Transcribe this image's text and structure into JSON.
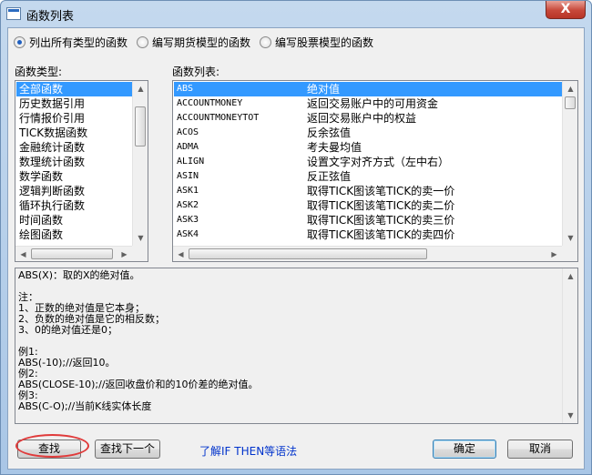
{
  "window": {
    "title": "函数列表",
    "close_glyph": "X"
  },
  "filter": {
    "options": [
      {
        "label": "列出所有类型的函数",
        "selected": true
      },
      {
        "label": "编写期货模型的函数",
        "selected": false
      },
      {
        "label": "编写股票模型的函数",
        "selected": false
      }
    ]
  },
  "types": {
    "label": "函数类型:",
    "items": [
      "全部函数",
      "历史数据引用",
      "行情报价引用",
      "TICK数据函数",
      "金融统计函数",
      "数理统计函数",
      "数学函数",
      "逻辑判断函数",
      "循环执行函数",
      "时间函数",
      "绘图函数"
    ],
    "selected_index": 0
  },
  "functions": {
    "label": "函数列表:",
    "rows": [
      {
        "name": "ABS",
        "desc": "绝对值"
      },
      {
        "name": "ACCOUNTMONEY",
        "desc": "返回交易账户中的可用资金"
      },
      {
        "name": "ACCOUNTMONEYTOT",
        "desc": "返回交易账户中的权益"
      },
      {
        "name": "ACOS",
        "desc": "反余弦值"
      },
      {
        "name": "ADMA",
        "desc": "考夫曼均值"
      },
      {
        "name": "ALIGN",
        "desc": "设置文字对齐方式（左中右）"
      },
      {
        "name": "ASIN",
        "desc": "反正弦值"
      },
      {
        "name": "ASK1",
        "desc": "取得TICK图该笔TICK的卖一价"
      },
      {
        "name": "ASK2",
        "desc": "取得TICK图该笔TICK的卖二价"
      },
      {
        "name": "ASK3",
        "desc": "取得TICK图该笔TICK的卖三价"
      },
      {
        "name": "ASK4",
        "desc": "取得TICK图该笔TICK的卖四价"
      }
    ],
    "selected_index": 0
  },
  "help": {
    "text": "ABS(X)：取的X的绝对值。\n\n注：\n1、正数的绝对值是它本身；\n2、负数的绝对值是它的相反数；\n3、0的绝对值还是0；\n\n例1:\nABS(-10);//返回10。\n例2:\nABS(CLOSE-10);//返回收盘价和的10价差的绝对值。\n例3:\nABS(C-O);//当前K线实体长度"
  },
  "buttons": {
    "find": "查找",
    "find_next": "查找下一个",
    "syntax_link": "了解IF THEN等语法",
    "ok": "确定",
    "cancel": "取消"
  },
  "colors": {
    "selection": "#3399ff",
    "link": "#0033cc",
    "highlight_ring": "#e03a3a"
  }
}
